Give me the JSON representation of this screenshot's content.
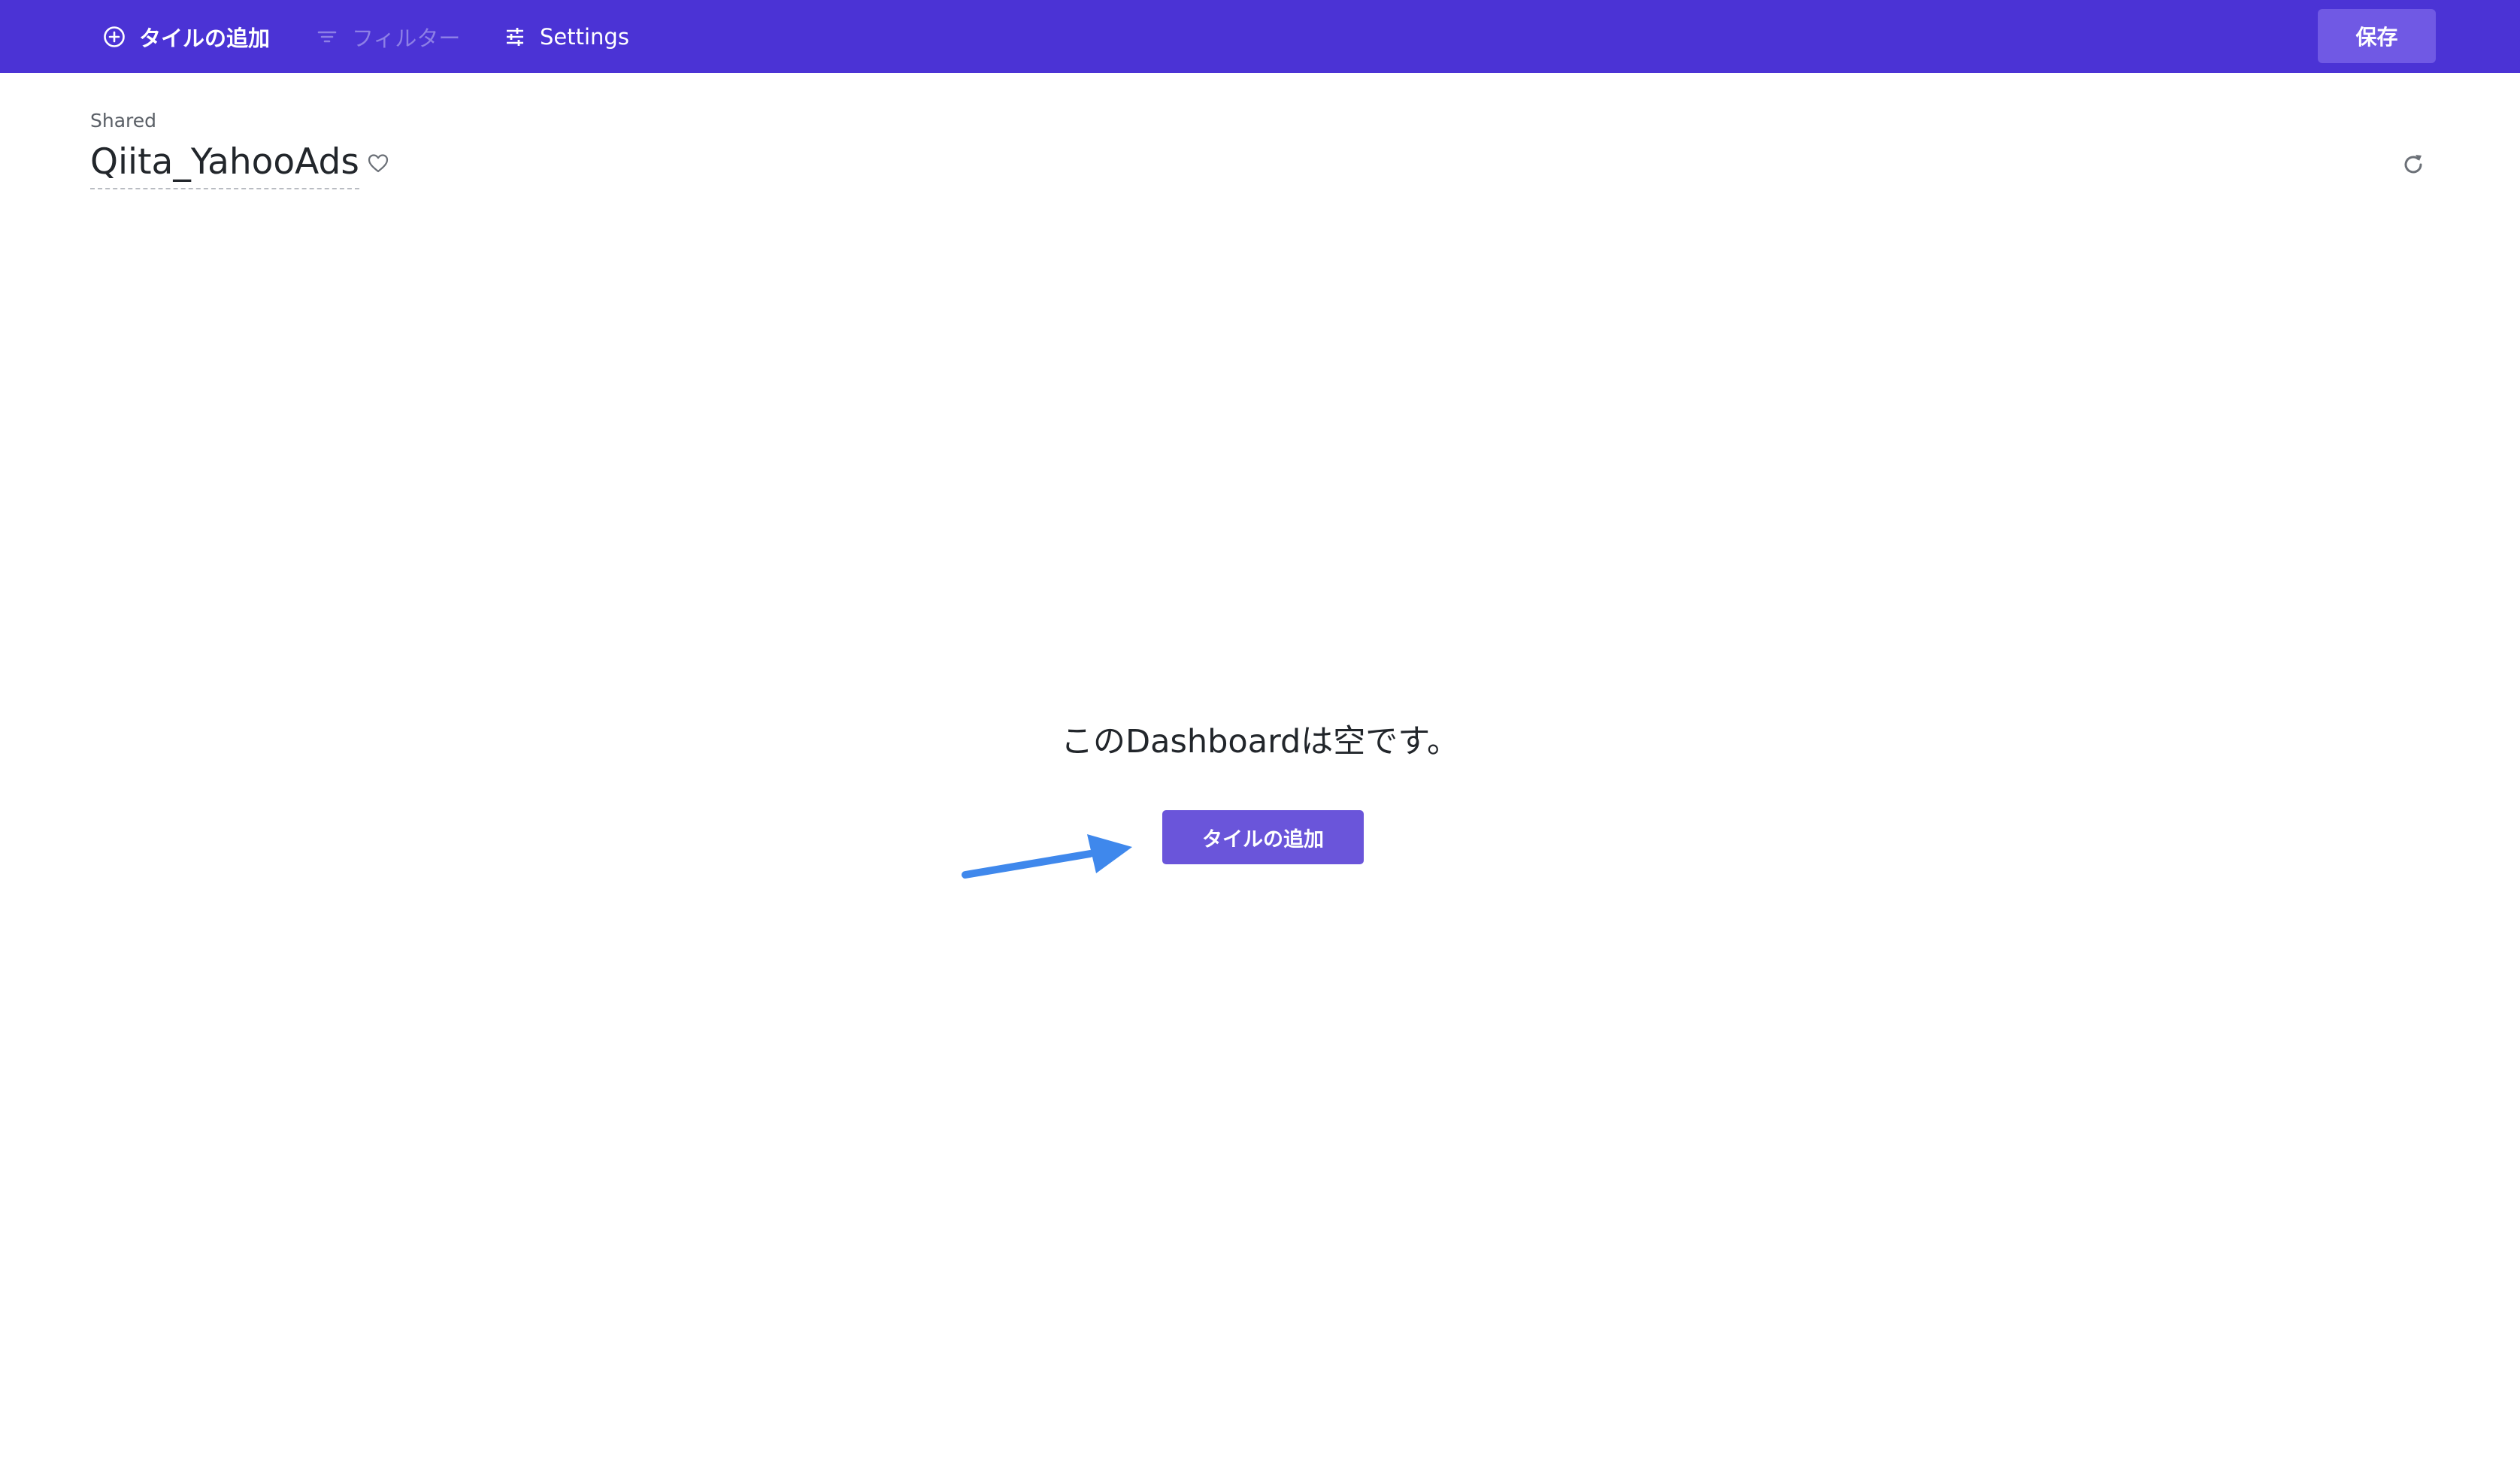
{
  "toolbar": {
    "add_tile_label": "タイルの追加",
    "filter_label": "フィルター",
    "settings_label": "Settings",
    "save_label": "保存"
  },
  "header": {
    "folder_label": "Shared",
    "dashboard_title": "Qiita_YahooAds"
  },
  "empty_state": {
    "message": "このDashboardは空です。",
    "add_tile_button_label": "タイルの追加"
  },
  "icons": {
    "add": "plus-circle-icon",
    "filter": "filter-icon",
    "settings": "sliders-icon",
    "favorite": "heart-icon",
    "refresh": "refresh-icon",
    "annotation": "arrow-icon"
  },
  "colors": {
    "toolbar_background": "#4b33d5",
    "save_button": "#7059e4",
    "primary_button": "#6a55da",
    "disabled_text": "#8d7fe6",
    "annotation_arrow": "#3f88ec"
  }
}
